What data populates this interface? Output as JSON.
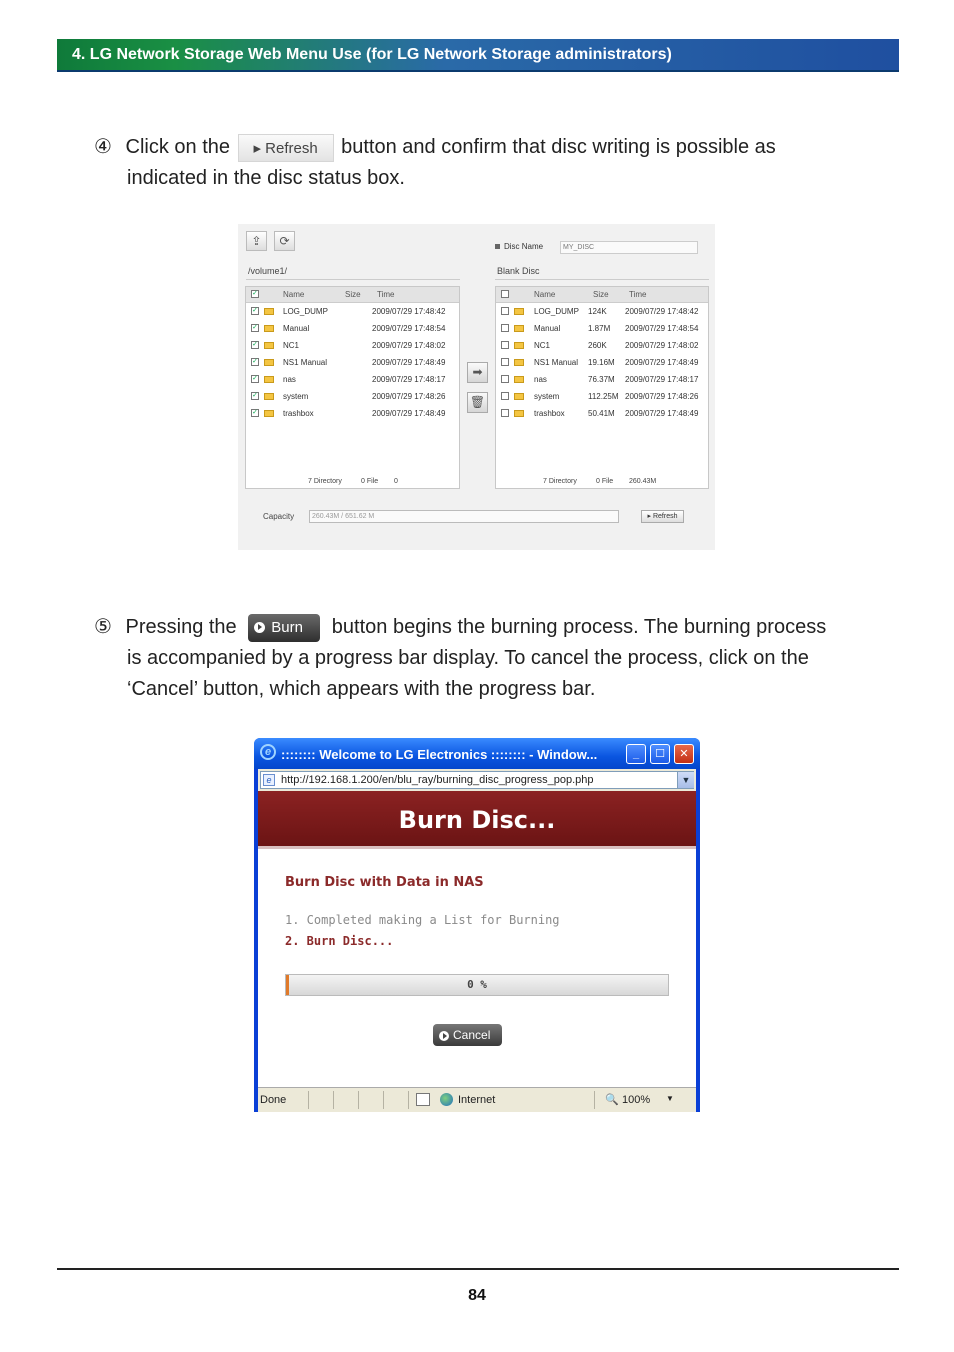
{
  "header": {
    "title": "4. LG Network Storage Web Menu Use (for LG Network Storage administrators)"
  },
  "step4": {
    "number": "④",
    "before_button": "Click on the",
    "button_label": "Refresh",
    "after_button": "button and confirm that disc writing is possible as",
    "line2": "indicated in the disc status box."
  },
  "disc_manager": {
    "left_path": "/volume1/",
    "disc_name_label": "Disc Name",
    "disc_name_value": "MY_DISC",
    "right_status": "Blank Disc",
    "columns": {
      "name": "Name",
      "size": "Size",
      "time": "Time"
    },
    "left_rows": [
      {
        "name": "LOG_DUMP",
        "size": "",
        "time": "2009/07/29 17:48:42"
      },
      {
        "name": "Manual",
        "size": "",
        "time": "2009/07/29 17:48:54"
      },
      {
        "name": "NC1",
        "size": "",
        "time": "2009/07/29 17:48:02"
      },
      {
        "name": "NS1 Manual",
        "size": "",
        "time": "2009/07/29 17:48:49"
      },
      {
        "name": "nas",
        "size": "",
        "time": "2009/07/29 17:48:17"
      },
      {
        "name": "system",
        "size": "",
        "time": "2009/07/29 17:48:26"
      },
      {
        "name": "trashbox",
        "size": "",
        "time": "2009/07/29 17:48:49"
      }
    ],
    "right_rows": [
      {
        "name": "LOG_DUMP",
        "size": "124K",
        "time": "2009/07/29 17:48:42"
      },
      {
        "name": "Manual",
        "size": "1.87M",
        "time": "2009/07/29 17:48:54"
      },
      {
        "name": "NC1",
        "size": "260K",
        "time": "2009/07/29 17:48:02"
      },
      {
        "name": "NS1 Manual",
        "size": "19.16M",
        "time": "2009/07/29 17:48:49"
      },
      {
        "name": "nas",
        "size": "76.37M",
        "time": "2009/07/29 17:48:17"
      },
      {
        "name": "system",
        "size": "112.25M",
        "time": "2009/07/29 17:48:26"
      },
      {
        "name": "trashbox",
        "size": "50.41M",
        "time": "2009/07/29 17:48:49"
      }
    ],
    "left_footer": {
      "dirs": "7 Directory",
      "files": "0 File",
      "size": "0"
    },
    "right_footer": {
      "dirs": "7 Directory",
      "files": "0 File",
      "size": "260.43M"
    },
    "capacity_label": "Capacity",
    "capacity_value": "260.43M / 651.62 M",
    "refresh_label": "Refresh"
  },
  "step5": {
    "number": "⑤",
    "before_button": "Pressing the",
    "button_label": "Burn",
    "after_button": "button begins the burning process. The burning process",
    "line2": "is accompanied by a progress bar display. To cancel the process, click on the",
    "line3": "‘Cancel’ button, which appears with the progress bar."
  },
  "popup": {
    "title": ":::::::: Welcome to LG Electronics :::::::: - Window...",
    "url": "http://192.168.1.200/en/blu_ray/burning_disc_progress_pop.php",
    "banner": "Burn Disc...",
    "heading": "Burn Disc with Data in NAS",
    "step1": "1. Completed making a List for Burning",
    "step2": "2. Burn Disc...",
    "progress_percent": 0,
    "progress_text": "0 %",
    "cancel_label": "Cancel",
    "status": {
      "done": "Done",
      "zone": "Internet",
      "zoom": "100%"
    }
  },
  "footer": {
    "page_number": "84"
  },
  "colors": {
    "accent_red": "#8b2222",
    "header_green": "#1a8f44",
    "header_blue": "#1f4fa0"
  }
}
